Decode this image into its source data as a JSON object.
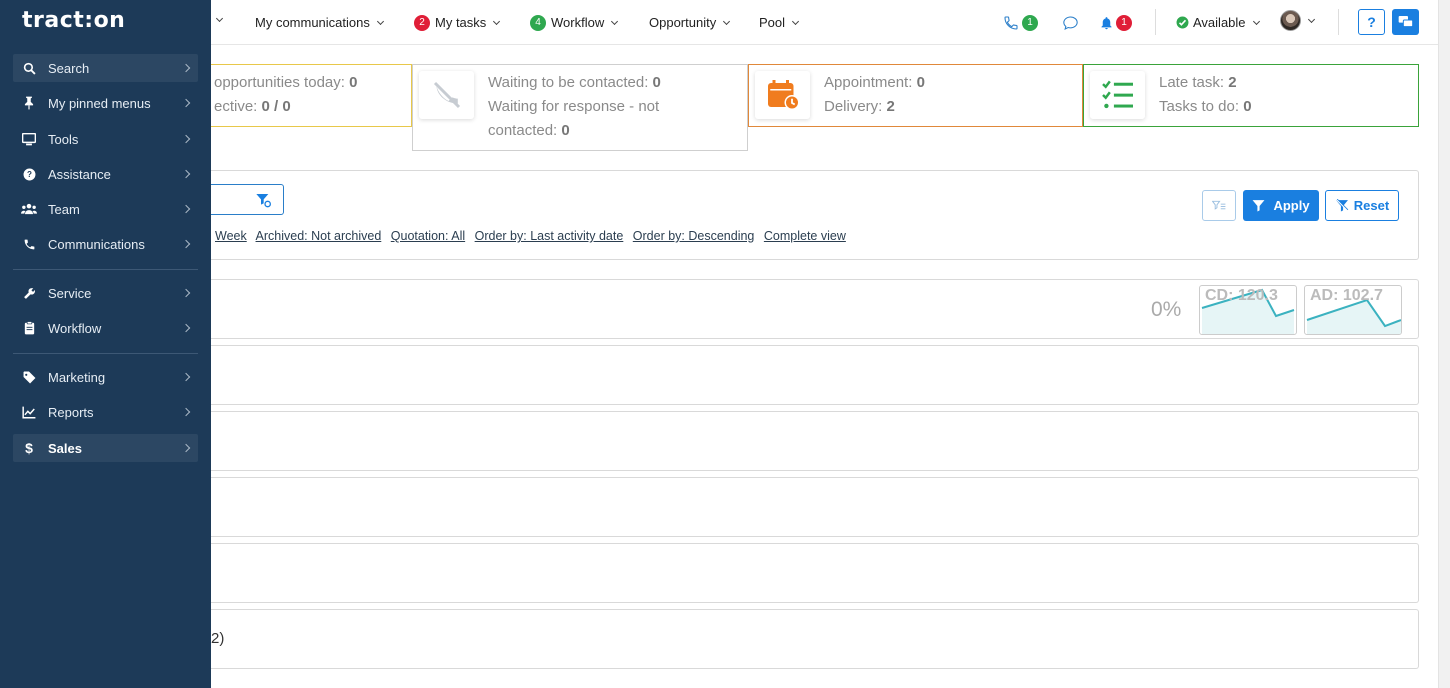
{
  "brand": {
    "logo": "tract:on"
  },
  "topnav": {
    "items": [
      {
        "label": "My communications"
      },
      {
        "label": "My tasks",
        "badge": "2"
      },
      {
        "label": "Workflow",
        "badge": "4"
      },
      {
        "label": "Opportunity"
      },
      {
        "label": "Pool"
      }
    ],
    "phone_badge": "1",
    "bell_badge": "1",
    "status": "Available",
    "help": "?"
  },
  "stats": {
    "box1": {
      "line1": "opportunities today:",
      "val1": "0",
      "line2": "ective:",
      "val2": "0 / 0"
    },
    "box2": {
      "line1": "Waiting to be contacted:",
      "val1": "0",
      "line2a": "Waiting for response - not",
      "line2b": "contacted:",
      "val2": "0"
    },
    "box3": {
      "line1": "Appointment:",
      "val1": "0",
      "line2": "Delivery:",
      "val2": "2"
    },
    "box4": {
      "line1": "Late task:",
      "val1": "2",
      "line2": "Tasks to do:",
      "val2": "0"
    }
  },
  "filters": {
    "chips": [
      "Week",
      "Archived: Not archived",
      "Quotation: All",
      "Order by: Last activity date",
      "Order by: Descending",
      "Complete view"
    ],
    "apply": "Apply",
    "reset": "Reset"
  },
  "rows": {
    "percent": "0%",
    "cd_label": "CD: 120.3",
    "ad_label": "AD: 102.7",
    "last_row_fragment": "2)"
  },
  "sidebar": {
    "items": [
      {
        "label": "Search"
      },
      {
        "label": "My pinned menus"
      },
      {
        "label": "Tools"
      },
      {
        "label": "Assistance"
      },
      {
        "label": "Team"
      },
      {
        "label": "Communications"
      },
      {
        "label": "Service"
      },
      {
        "label": "Workflow"
      },
      {
        "label": "Marketing"
      },
      {
        "label": "Reports"
      },
      {
        "label": "Sales"
      }
    ]
  },
  "colors": {
    "sidebar_bg": "#1d3a58",
    "primary": "#1a7fe0",
    "stat_yellow": "#e8c84a",
    "stat_orange": "#e0883a",
    "stat_green": "#3aa33a",
    "spark_line": "#3bb2c0"
  }
}
